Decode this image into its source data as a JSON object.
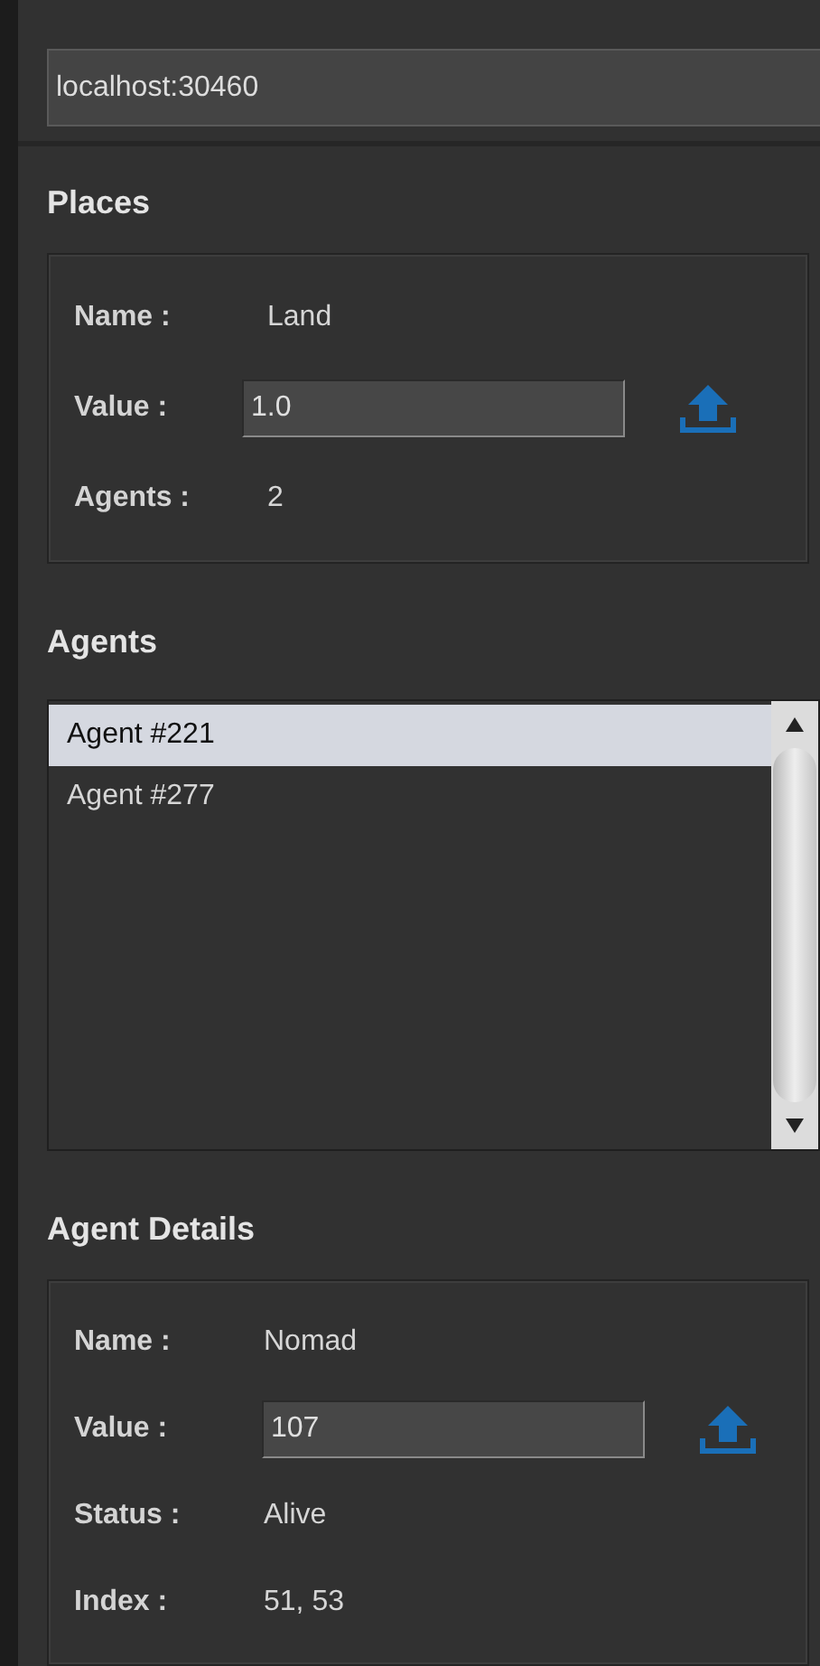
{
  "address": {
    "value": "localhost:30460"
  },
  "places": {
    "title": "Places",
    "fields": [
      {
        "kind": "text",
        "label": "Name :",
        "value": "Land"
      },
      {
        "kind": "input",
        "label": "Value :",
        "value": "1.0"
      },
      {
        "kind": "text",
        "label": "Agents :",
        "value": "2"
      }
    ]
  },
  "agents": {
    "title": "Agents",
    "items": [
      {
        "label": "Agent #221",
        "selected": true
      },
      {
        "label": "Agent #277",
        "selected": false
      }
    ]
  },
  "agent_details": {
    "title": "Agent Details",
    "fields": [
      {
        "kind": "text",
        "label": "Name :",
        "value": "Nomad"
      },
      {
        "kind": "input",
        "label": "Value :",
        "value": "107"
      },
      {
        "kind": "text",
        "label": "Status :",
        "value": "Alive"
      },
      {
        "kind": "text",
        "label": "Index :",
        "value": "51, 53"
      }
    ]
  }
}
